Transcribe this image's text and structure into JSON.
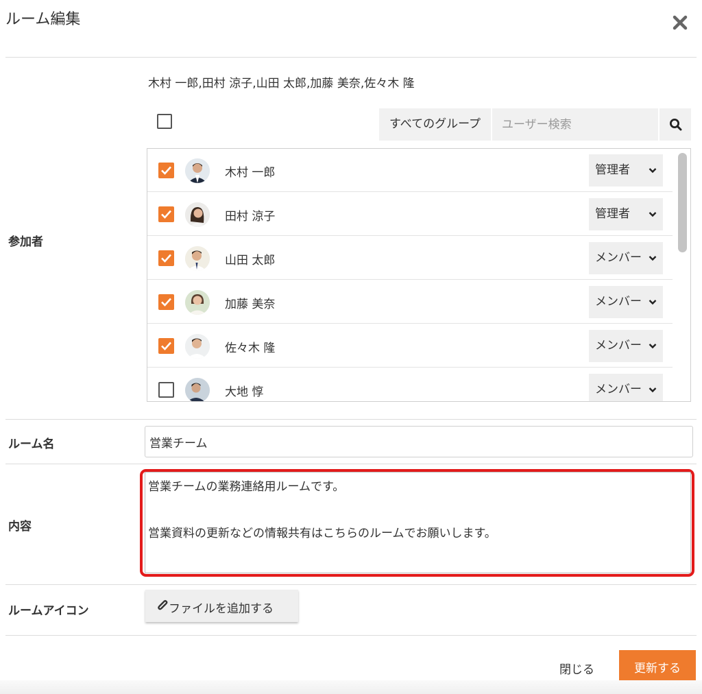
{
  "dialog": {
    "title": "ルーム編集"
  },
  "participants": {
    "label": "参加者",
    "selected_names": "木村 一郎,田村 涼子,山田 太郎,加藤 美奈,佐々木 隆",
    "group_filter": "すべてのグループ",
    "search_placeholder": "ユーザー検索",
    "members": [
      {
        "name": "木村 一郎",
        "checked": true,
        "role": "管理者"
      },
      {
        "name": "田村 涼子",
        "checked": true,
        "role": "管理者"
      },
      {
        "name": "山田 太郎",
        "checked": true,
        "role": "メンバー"
      },
      {
        "name": "加藤 美奈",
        "checked": true,
        "role": "メンバー"
      },
      {
        "name": "佐々木 隆",
        "checked": true,
        "role": "メンバー"
      },
      {
        "name": "大地 惇",
        "checked": false,
        "role": "メンバー"
      }
    ]
  },
  "room_name": {
    "label": "ルーム名",
    "value": "営業チーム"
  },
  "content": {
    "label": "内容",
    "value": "営業チームの業務連絡用ルームです。\n\n営業資料の更新などの情報共有はこちらのルームでお願いします。"
  },
  "room_icon": {
    "label": "ルームアイコン",
    "add_file": "ファイルを追加する"
  },
  "footer": {
    "close": "閉じる",
    "update": "更新する"
  },
  "colors": {
    "accent": "#ef7b2d",
    "highlight": "#e31b1b"
  }
}
